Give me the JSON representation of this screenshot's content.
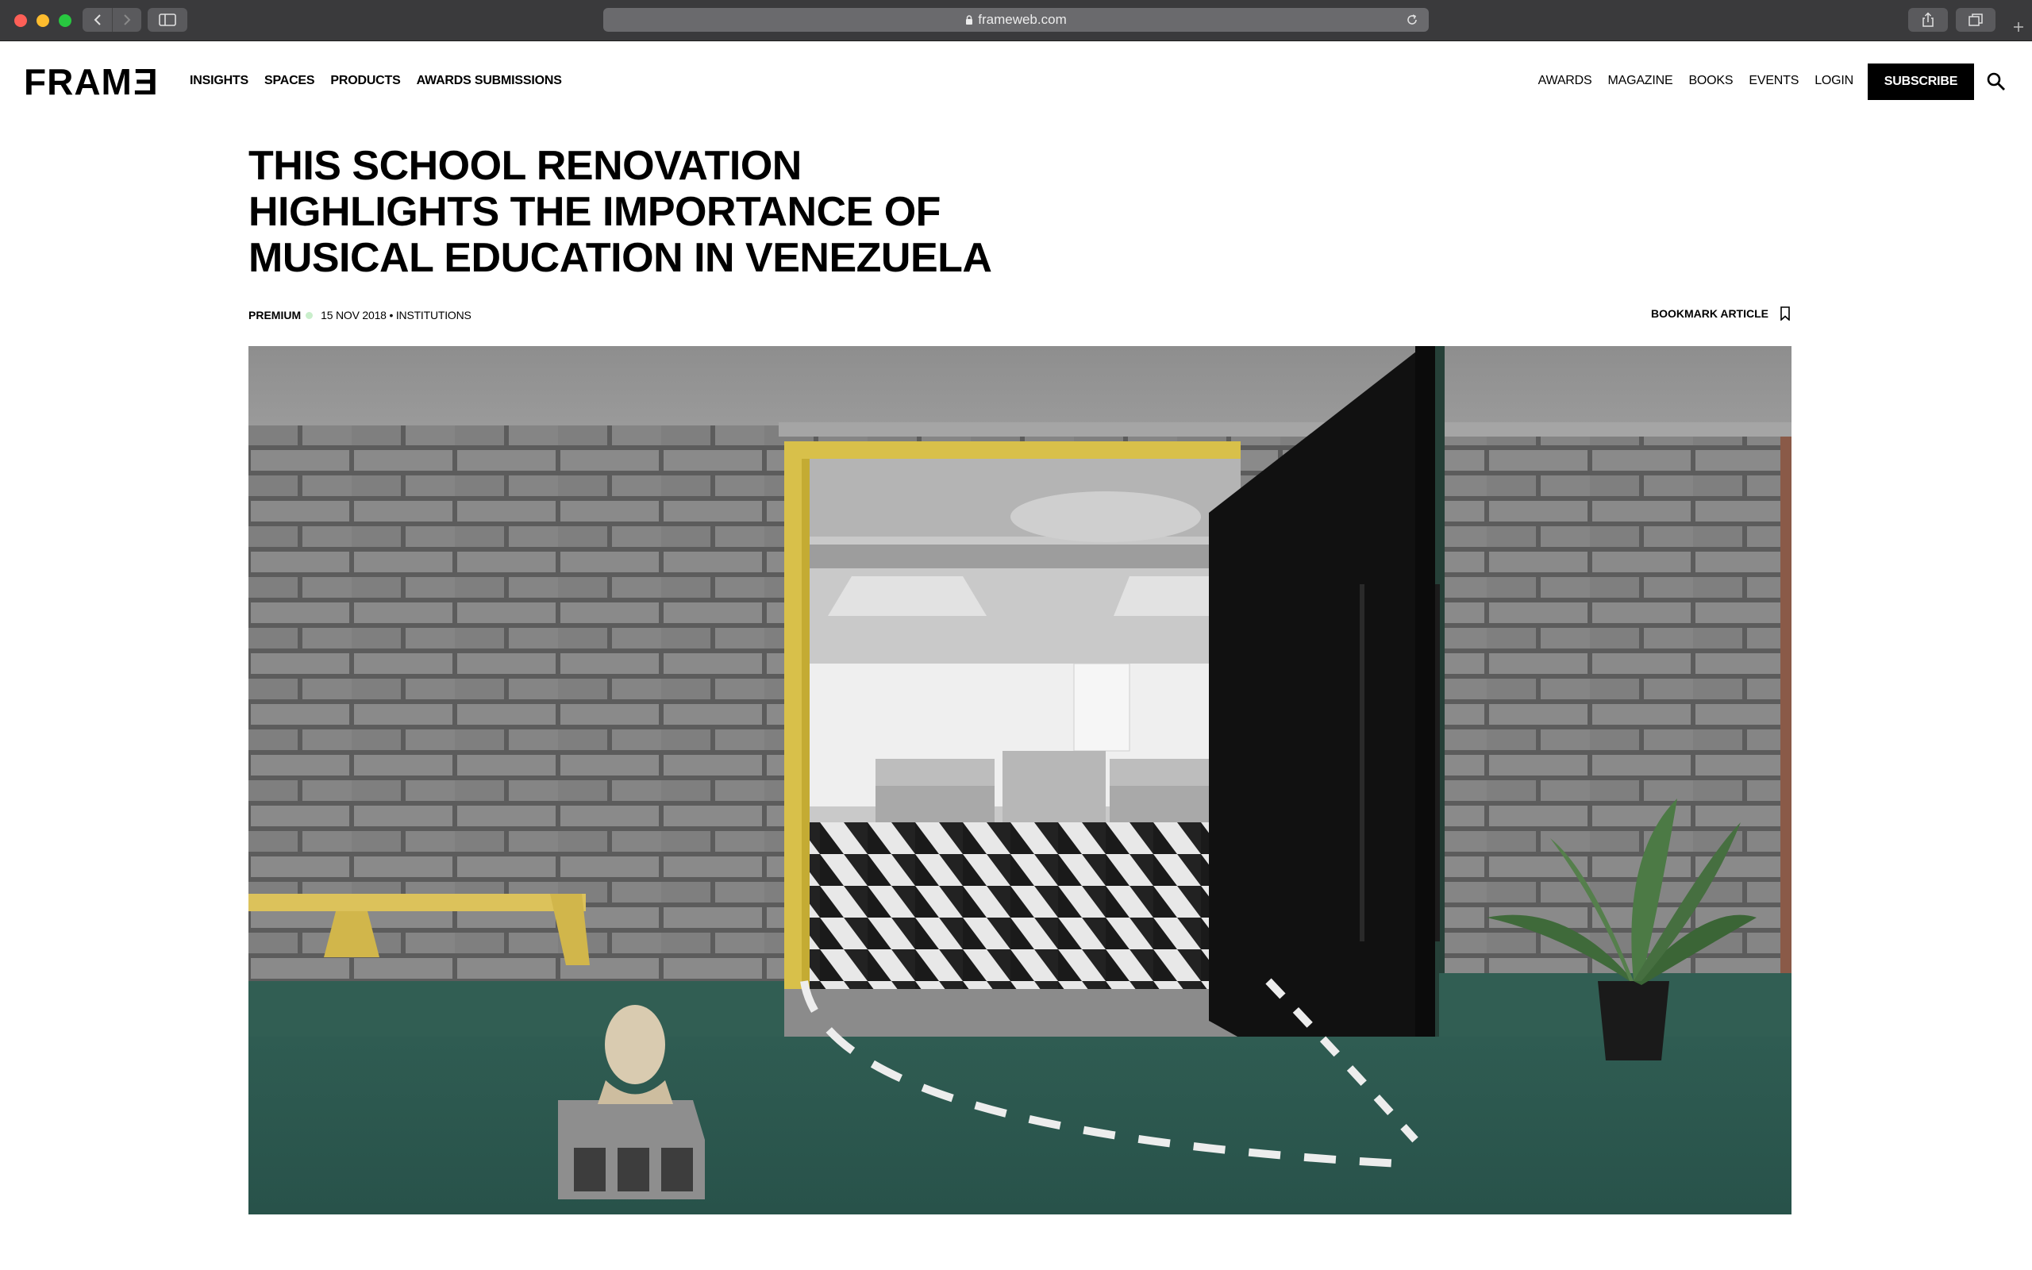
{
  "browser": {
    "url": "frameweb.com"
  },
  "site": {
    "logo": "FRAME",
    "main_nav": [
      "INSIGHTS",
      "SPACES",
      "PRODUCTS",
      "AWARDS SUBMISSIONS"
    ],
    "util_nav": [
      "AWARDS",
      "MAGAZINE",
      "BOOKS",
      "EVENTS",
      "LOGIN"
    ],
    "subscribe_label": "SUBSCRIBE"
  },
  "article": {
    "title_lines": [
      "THIS SCHOOL RENOVATION",
      "HIGHLIGHTS THE IMPORTANCE OF",
      "MUSICAL EDUCATION IN VENEZUELA"
    ],
    "tag": "PREMIUM",
    "date_category": "15 NOV 2018 • INSTITUTIONS",
    "bookmark_label": "BOOKMARK ARTICLE"
  },
  "colors": {
    "premium_dot": "#c9eecb",
    "subscribe_bg": "#000000",
    "door_frame": "#d8c04a",
    "floor": "#2e5c51"
  }
}
